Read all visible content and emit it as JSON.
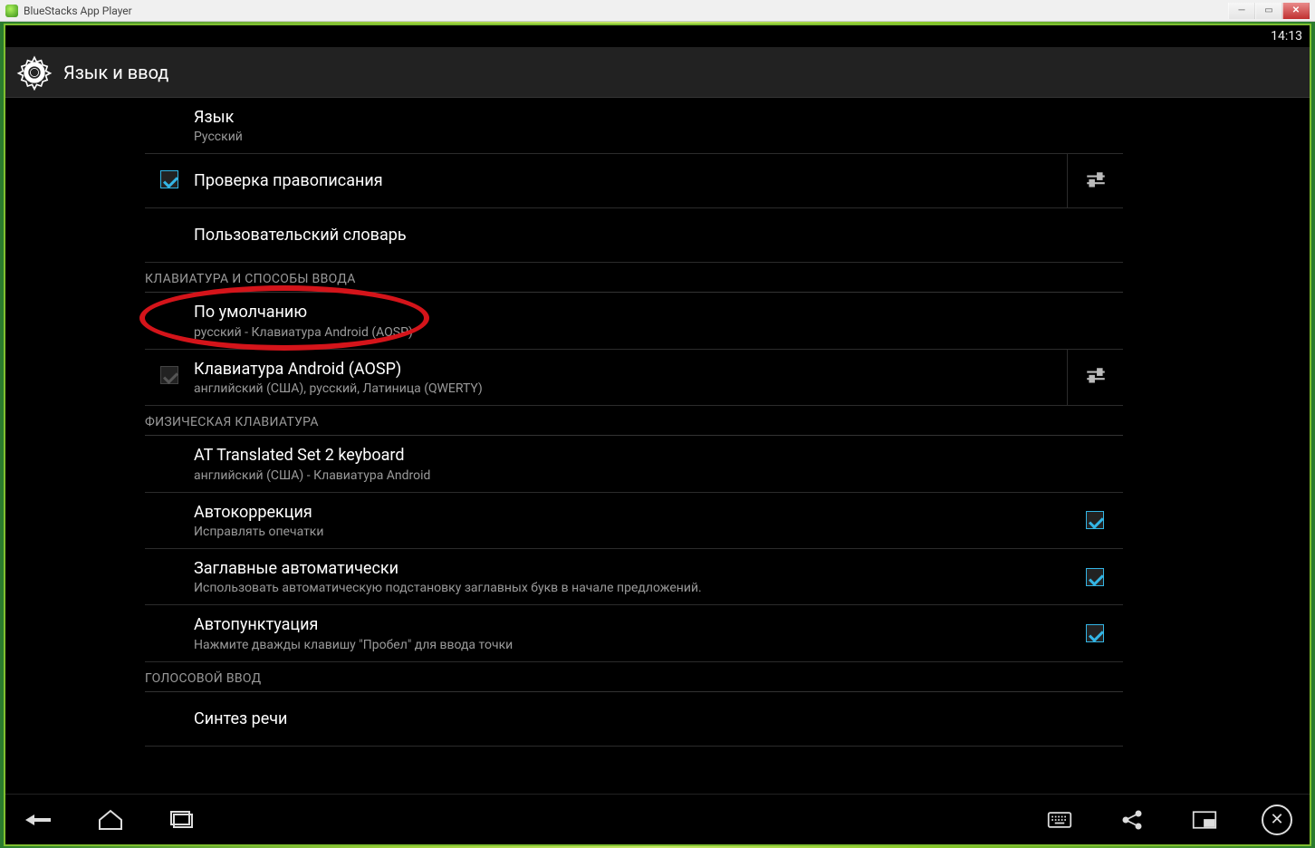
{
  "window": {
    "title": "BlueStacks App Player"
  },
  "statusbar": {
    "time": "14:13"
  },
  "header": {
    "title": "Язык и ввод"
  },
  "rows": {
    "lang": {
      "title": "Язык",
      "sub": "Русский"
    },
    "spellcheck": {
      "title": "Проверка правописания"
    },
    "dict": {
      "title": "Пользовательский словарь"
    },
    "section_kb": "КЛАВИАТУРА И СПОСОБЫ ВВОДА",
    "default": {
      "title": "По умолчанию",
      "sub": "русский - Клавиатура Android (AOSP)"
    },
    "aosp": {
      "title": "Клавиатура Android (AOSP)",
      "sub": "английский (США), русский, Латиница (QWERTY)"
    },
    "section_phys": "ФИЗИЧЕСКАЯ КЛАВИАТУРА",
    "physkb": {
      "title": "AT Translated Set 2 keyboard",
      "sub": "английский (США) - Клавиатура Android"
    },
    "autocorr": {
      "title": "Автокоррекция",
      "sub": "Исправлять опечатки"
    },
    "autocap": {
      "title": "Заглавные автоматически",
      "sub": "Использовать автоматическую подстановку заглавных букв в начале предложений."
    },
    "autopunct": {
      "title": "Автопунктуация",
      "sub": "Нажмите дважды клавишу \"Пробел\" для ввода точки"
    },
    "section_voice": "ГОЛОСОВОЙ ВВОД",
    "tts": {
      "title": "Синтез речи"
    }
  }
}
